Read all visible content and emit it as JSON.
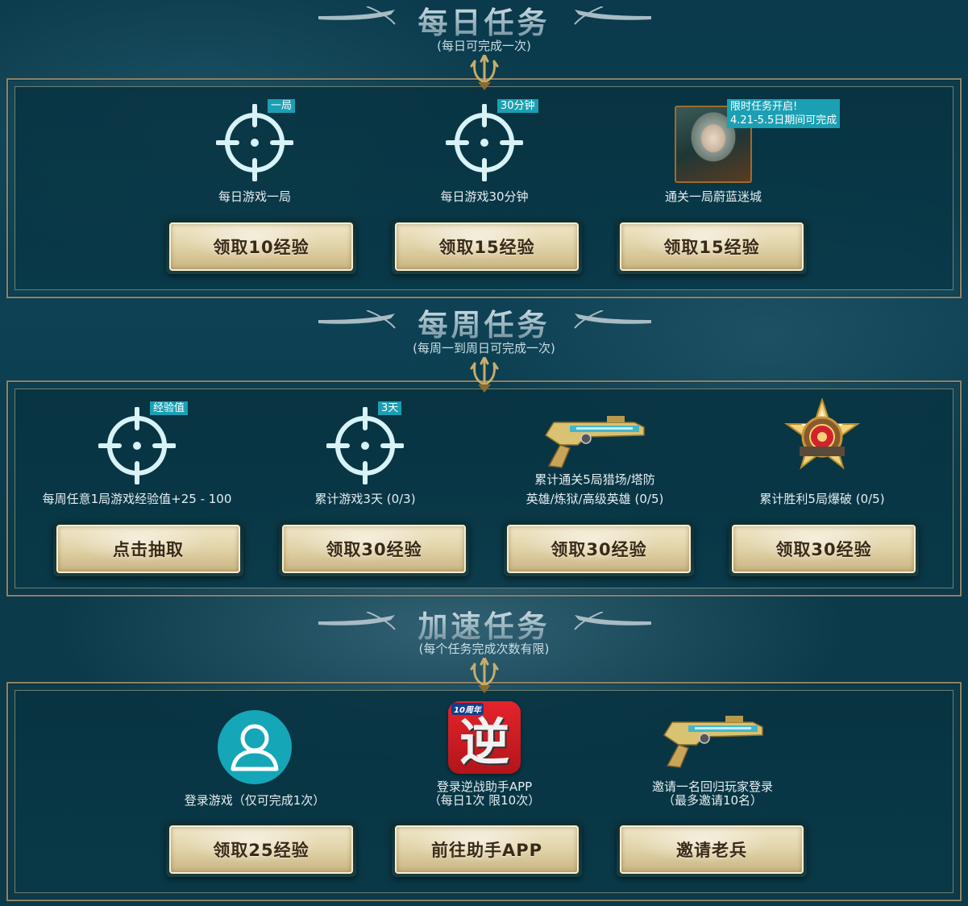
{
  "sections": {
    "daily": {
      "title": "每日任务",
      "subtitle": "(每日可完成一次)"
    },
    "weekly": {
      "title": "每周任务",
      "subtitle": "(每周一到周日可完成一次)"
    },
    "speed": {
      "title": "加速任务",
      "subtitle": "(每个任务完成次数有限)"
    }
  },
  "daily_tasks": [
    {
      "icon": "crosshair-icon",
      "badge": "一局",
      "label": "每日游戏一局",
      "button": "领取10经验"
    },
    {
      "icon": "crosshair-icon",
      "badge": "30分钟",
      "label": "每日游戏30分钟",
      "button": "领取15经验"
    },
    {
      "icon": "hero-portrait",
      "badge_line1": "限时任务开启!",
      "badge_line2": "4.21-5.5日期间可完成",
      "label": "通关一局蔚蓝迷城",
      "button": "领取15经验"
    }
  ],
  "weekly_tasks": [
    {
      "icon": "crosshair-icon",
      "badge": "经验值",
      "label": "每周任意1局游戏经验值+25 - 100",
      "button": "点击抽取"
    },
    {
      "icon": "crosshair-icon",
      "badge": "3天",
      "label": "累计游戏3天 (0/3)",
      "button": "领取30经验"
    },
    {
      "icon": "gun-icon",
      "label_line1": "累计通关5局猎场/塔防",
      "label_line2": "英雄/炼狱/高级英雄 (0/5)",
      "button": "领取30经验"
    },
    {
      "icon": "medal-icon",
      "label": "累计胜利5局爆破 (0/5)",
      "button": "领取30经验"
    }
  ],
  "speed_tasks": [
    {
      "icon": "user-icon",
      "label": "登录游戏（仅可完成1次）",
      "button": "领取25经验"
    },
    {
      "icon": "app-icon",
      "app_char": "逆",
      "app_tag": "10周年",
      "label_line1": "登录逆战助手APP",
      "label_line2": "（每日1次 限10次）",
      "button": "前往助手APP"
    },
    {
      "icon": "gun-icon",
      "label_line1": "邀请一名回归玩家登录",
      "label_line2": "（最多邀请10名）",
      "button": "邀请老兵"
    }
  ],
  "colors": {
    "accent": "#1b9fb3",
    "icon": "#d8f3f7",
    "gold_border": "#8e8264",
    "button_text": "#3b2a16"
  }
}
